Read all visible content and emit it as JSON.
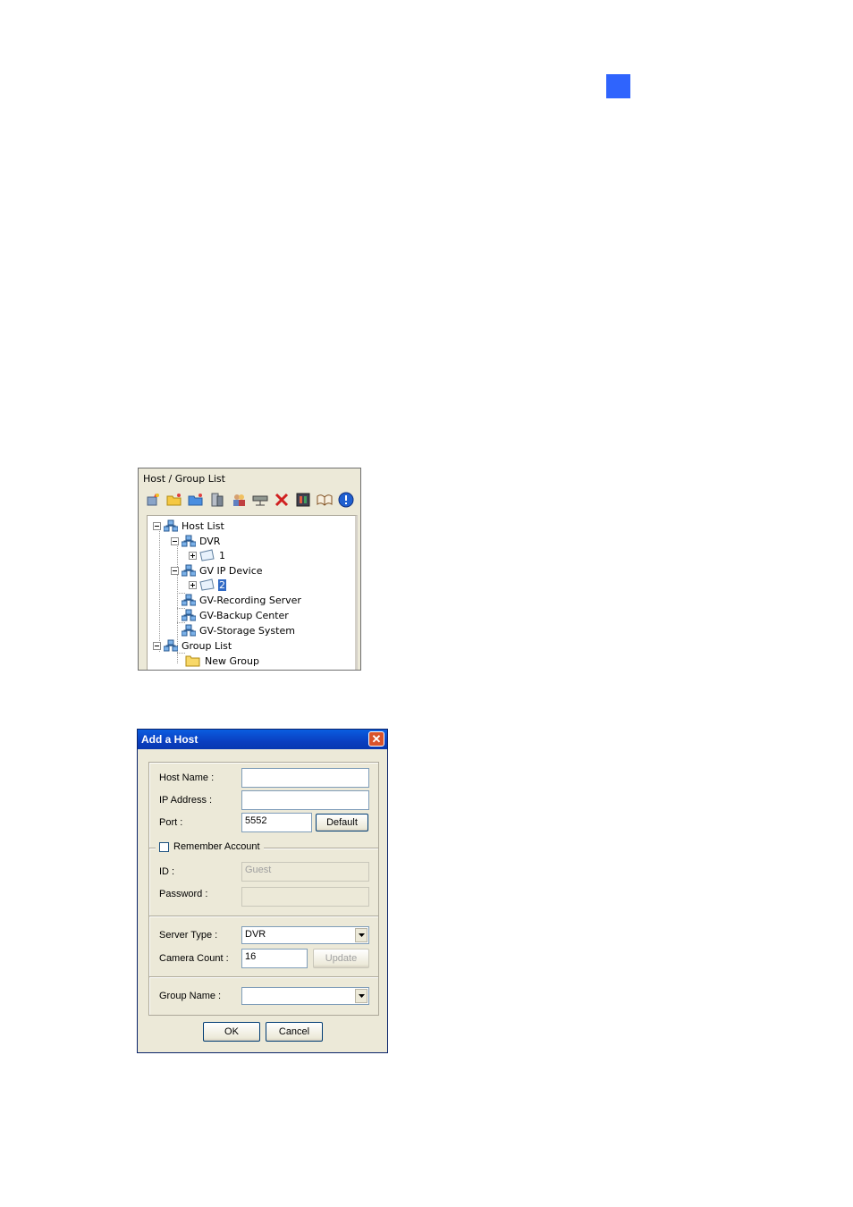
{
  "marker_color": "#2f64fd",
  "host_group_panel": {
    "title": "Host / Group List",
    "toolbar": [
      "add-host-icon",
      "open-folder-icon",
      "folder-icon",
      "server-icon",
      "user-group-icon",
      "network-icon",
      "delete-icon",
      "film-icon",
      "book-icon",
      "info-icon"
    ],
    "tree": {
      "host_list": "Host List",
      "dvr": "DVR",
      "dvr_child": "1",
      "gv_ip_device": "GV IP Device",
      "gv_ip_child": "2",
      "gv_recording_server": "GV-Recording Server",
      "gv_backup_center": "GV-Backup Center",
      "gv_storage_system": "GV-Storage System",
      "group_list": "Group List",
      "new_group": "New Group"
    }
  },
  "add_host_dialog": {
    "title": "Add a Host",
    "host_name_label": "Host Name :",
    "host_name_value": "",
    "ip_address_label": "IP Address :",
    "ip_address_value": "",
    "port_label": "Port :",
    "port_value": "5552",
    "default_button": "Default",
    "remember_account_label": "Remember Account",
    "remember_account_checked": false,
    "id_label": "ID :",
    "id_value": "Guest",
    "password_label": "Password :",
    "password_value": "",
    "server_type_label": "Server Type :",
    "server_type_value": "DVR",
    "camera_count_label": "Camera Count :",
    "camera_count_value": "16",
    "update_button": "Update",
    "group_name_label": "Group Name :",
    "group_name_value": "",
    "ok_button": "OK",
    "cancel_button": "Cancel"
  }
}
